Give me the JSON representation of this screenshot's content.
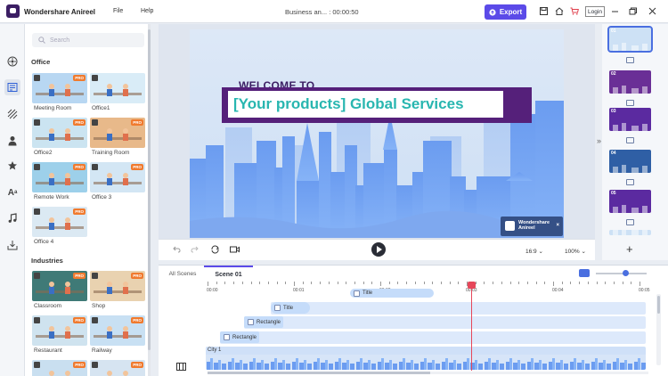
{
  "app": {
    "name": "Wondershare Anireel",
    "doc_title": "Business an... : 00:00:50"
  },
  "menu": {
    "file": "File",
    "help": "Help"
  },
  "toolbar": {
    "export_label": "Export",
    "login_label": "Login"
  },
  "left_rail": {
    "icons": [
      "scene-icon",
      "template-icon",
      "background-icon",
      "character-icon",
      "prop-icon",
      "text-icon",
      "music-icon",
      "import-icon"
    ],
    "active": "template-icon"
  },
  "panel": {
    "search_placeholder": "Search",
    "sections": [
      {
        "title": "Office",
        "items": [
          {
            "label": "Meeting Room",
            "pro": "PRO",
            "bg": "#b8d7f2"
          },
          {
            "label": "Office1",
            "pro": "",
            "bg": "#d9ecf7"
          },
          {
            "label": "Office2",
            "pro": "PRO",
            "bg": "#cbe4f1"
          },
          {
            "label": "Training Room",
            "pro": "PRO",
            "bg": "#e8b98a"
          },
          {
            "label": "Remote Work",
            "pro": "PRO",
            "bg": "#9dd0ea"
          },
          {
            "label": "Office 3",
            "pro": "PRO",
            "bg": "#d3e6f4"
          },
          {
            "label": "Office 4",
            "pro": "PRO",
            "bg": "#dbe9f3"
          }
        ]
      },
      {
        "title": "Industries",
        "items": [
          {
            "label": "Classroom",
            "pro": "PRO",
            "bg": "#3f7a77"
          },
          {
            "label": "Shop",
            "pro": "PRO",
            "bg": "#e9d2b0"
          },
          {
            "label": "Restaurant",
            "pro": "PRO",
            "bg": "#cfe3ef"
          },
          {
            "label": "Railway",
            "pro": "PRO",
            "bg": "#c8e0f3"
          },
          {
            "label": "",
            "pro": "PRO",
            "bg": "#c9dff0"
          },
          {
            "label": "",
            "pro": "PRO",
            "bg": "#d6e4f1"
          }
        ]
      }
    ]
  },
  "canvas": {
    "welcome": "WELCOME TO",
    "banner": "[Your products] Global Services",
    "watermark_line1": "Wondershare",
    "watermark_line2": "Anireel",
    "watermark_close": "×"
  },
  "controls": {
    "ratio": "16:9",
    "zoom": "100%"
  },
  "scenes": [
    {
      "num": "01",
      "bg": "#cde1f5"
    },
    {
      "num": "02",
      "bg": "#6a2f96"
    },
    {
      "num": "03",
      "bg": "#5b2aa0"
    },
    {
      "num": "04",
      "bg": "#2f5fa5"
    },
    {
      "num": "05",
      "bg": "#5b2aa0"
    },
    {
      "num": "",
      "bg": "#cde1f5"
    }
  ],
  "timeline": {
    "tabs": [
      "All Scenes",
      "Scene 01"
    ],
    "ruler": [
      "00:00",
      "00:01",
      "00:02",
      "00:03",
      "00:04",
      "00:05"
    ],
    "tracks": [
      {
        "label": "Title"
      },
      {
        "label": "Title"
      },
      {
        "label": "Rectangle"
      },
      {
        "label": "Rectangle"
      },
      {
        "label": "City 1"
      }
    ]
  },
  "colors": {
    "accent": "#5b4ae8",
    "brand_purple": "#55207a",
    "teal": "#28b6b0",
    "playhead": "#e6475a"
  }
}
